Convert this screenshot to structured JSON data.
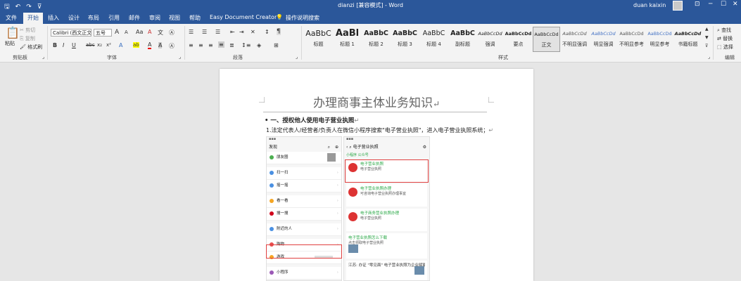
{
  "titlebar": {
    "title": "dianzi [兼容模式] - Word",
    "user": "duan kaixin",
    "qat": {
      "save": "🖫",
      "undo": "↶",
      "redo": "↷",
      "more": "⊽"
    },
    "window_controls": {
      "ribbon_options": "⊡",
      "minimize": "─",
      "maximize": "☐",
      "close": "✕"
    }
  },
  "tabs": [
    "文件",
    "开始",
    "插入",
    "设计",
    "布局",
    "引用",
    "邮件",
    "审阅",
    "视图",
    "帮助",
    "Easy Document Creator",
    "操作说明搜索"
  ],
  "active_tab": "开始",
  "ribbon": {
    "clipboard": {
      "paste": "粘贴",
      "cut": "剪切",
      "copy": "复制",
      "format_painter": "格式刷",
      "label": "剪贴板"
    },
    "font": {
      "font_name": "Calibri (西文正文)",
      "font_size": "五号",
      "grow": "A",
      "shrink": "A",
      "case": "Aa",
      "clear": "A",
      "wen": "文",
      "bold": "B",
      "italic": "I",
      "underline": "U",
      "strike": "abc",
      "subscript": "x₂",
      "superscript": "x²",
      "highlight": "ab",
      "color": "A",
      "effect": "A",
      "border": "A",
      "label": "字体"
    },
    "paragraph": {
      "label": "段落",
      "sort": "↕",
      "marks": "¶"
    },
    "styles": {
      "label": "样式",
      "items": [
        {
          "preview": "AaBbC",
          "name": "标题"
        },
        {
          "preview": "AaBl",
          "name": "标题 1"
        },
        {
          "preview": "AaBbC",
          "name": "标题 2"
        },
        {
          "preview": "AaBbC",
          "name": "标题 3"
        },
        {
          "preview": "AaBbC",
          "name": "标题 4"
        },
        {
          "preview": "AaBbC",
          "name": "副标题"
        },
        {
          "preview": "AaBbCcDd",
          "name": "强调"
        },
        {
          "preview": "AaBbCcDd",
          "name": "要点"
        },
        {
          "preview": "AaBbCcDd",
          "name": "正文"
        },
        {
          "preview": "AaBbCcDd",
          "name": "不明显强调"
        },
        {
          "preview": "AaBbCcDd",
          "name": "明显强调"
        },
        {
          "preview": "AaBbCcDd",
          "name": "不明显参考"
        },
        {
          "preview": "AaBbCcDd",
          "name": "明显参考"
        },
        {
          "preview": "AaBbCcDd",
          "name": "书籍标题"
        }
      ],
      "selected": "正文"
    },
    "editing": {
      "find": "查找",
      "replace": "替换",
      "select": "选择",
      "label": "编辑"
    }
  },
  "document": {
    "title": "办理商事主体业务知识",
    "heading1": "一、授权他人使用电子营业执照",
    "para1": "1.法定代表人/经营者/负责人在微信小程序搜索\"电子营业执照\"，进入电子营业执照系统；",
    "para_mark": "↵"
  },
  "phone1": {
    "header": "发现",
    "items": [
      "朋友圈",
      "扫一扫",
      "摇一摇",
      "看一看",
      "搜一搜",
      "附近的人",
      "购物",
      "游戏",
      "小程序"
    ]
  },
  "phone2": {
    "search": "电子营业执照",
    "tab": "小程序  公众号",
    "cards": [
      {
        "title": "电子营业执照",
        "desc": "电子营业执照"
      },
      {
        "title": "电子营业执照办理",
        "desc": "可咨询电子营业执照办理事宜"
      },
      {
        "title": "电子商务营业执照办理",
        "desc": "电子营业执照"
      },
      {
        "title": "电子营业执照怎么下载",
        "desc": "点击领取电子营业执照"
      },
      {
        "title": "江苏: 办证 \"零见面\" 电子营业执照为企业赋能",
        "desc": ""
      }
    ]
  }
}
